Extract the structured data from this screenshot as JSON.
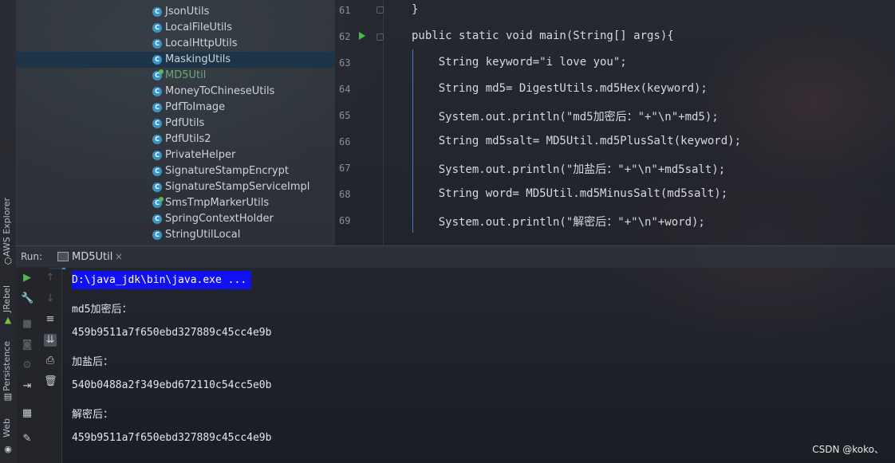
{
  "toolstrip": {
    "aws_label": "AWS Explorer",
    "jrebel_label": "JRebel",
    "persistence_label": "Persistence",
    "web_label": "Web"
  },
  "tree": {
    "items": [
      {
        "label": "JsonUtils",
        "selected": false,
        "modified": false
      },
      {
        "label": "LocalFileUtils",
        "selected": false,
        "modified": false
      },
      {
        "label": "LocalHttpUtils",
        "selected": false,
        "modified": false
      },
      {
        "label": "MaskingUtils",
        "selected": true,
        "modified": false
      },
      {
        "label": "MD5Util",
        "selected": false,
        "modified": true
      },
      {
        "label": "MoneyToChineseUtils",
        "selected": false,
        "modified": false
      },
      {
        "label": "PdfToImage",
        "selected": false,
        "modified": false
      },
      {
        "label": "PdfUtils",
        "selected": false,
        "modified": false
      },
      {
        "label": "PdfUtils2",
        "selected": false,
        "modified": false
      },
      {
        "label": "PrivateHelper",
        "selected": false,
        "modified": false
      },
      {
        "label": "SignatureStampEncrypt",
        "selected": false,
        "modified": false
      },
      {
        "label": "SignatureStampServiceImpl",
        "selected": false,
        "modified": false
      },
      {
        "label": "SmsTmpMarkerUtils",
        "selected": false,
        "modified": false
      },
      {
        "label": "SpringContextHolder",
        "selected": false,
        "modified": false
      },
      {
        "label": "StringUtilLocal",
        "selected": false,
        "modified": false
      }
    ]
  },
  "editor": {
    "line_numbers": [
      "61",
      "62",
      "63",
      "64",
      "65",
      "66",
      "67",
      "68",
      "69"
    ],
    "lines": [
      "}",
      "public static void main(String[] args){",
      "    String keyword=\"i love you\";",
      "    String md5= DigestUtils.md5Hex(keyword);",
      "    System.out.println(\"md5加密后：\"+\"\\n\"+md5);",
      "    String md5salt= MD5Util.md5PlusSalt(keyword);",
      "    System.out.println(\"加盐后：\"+\"\\n\"+md5salt);",
      "    String word= MD5Util.md5MinusSalt(md5salt);",
      "    System.out.println(\"解密后：\"+\"\\n\"+word);"
    ]
  },
  "run": {
    "title": "Run:",
    "tab_label": "MD5Util",
    "close_glyph": "×"
  },
  "console": {
    "lines": [
      "D:\\java_jdk\\bin\\java.exe ...",
      "md5加密后：",
      "459b9511a7f650ebd327889c45cc4e9b",
      "加盐后：",
      "540b0488a2f349ebd672110c54cc5e0b",
      "解密后：",
      "459b9511a7f650ebd327889c45cc4e9b"
    ]
  },
  "watermark": "CSDN @koko、"
}
